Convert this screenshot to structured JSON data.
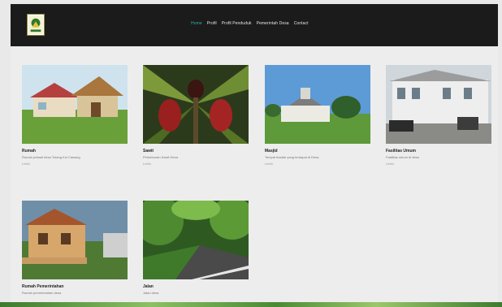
{
  "header": {
    "nav": [
      {
        "label": "Home"
      },
      {
        "label": "Profil"
      },
      {
        "label": "Profil Penduduk"
      },
      {
        "label": "Pemerintah Desa"
      },
      {
        "label": "Contact"
      }
    ]
  },
  "cards": [
    {
      "title": "Rumah",
      "desc": "Rumah pribadi desa Tulang Kol Cawang",
      "link": "Lebih"
    },
    {
      "title": "Sawit",
      "desc": "Perkebunan Sawit Desa",
      "link": "Lebih"
    },
    {
      "title": "Masjid",
      "desc": "Tempat ibadah yang terdapat di Desa",
      "link": "Lebih"
    },
    {
      "title": "Fasilitas Umum",
      "desc": "Fasilitas umum di desa",
      "link": "Lebih"
    },
    {
      "title": "Rumah Pemerintahan",
      "desc": "Rumah pemerintahan desa",
      "link": ""
    },
    {
      "title": "Jalan",
      "desc": "Jalan desa",
      "link": ""
    }
  ],
  "colors": {
    "nav_active": "#2fb0a0",
    "header_bg": "#1b1b1b"
  }
}
